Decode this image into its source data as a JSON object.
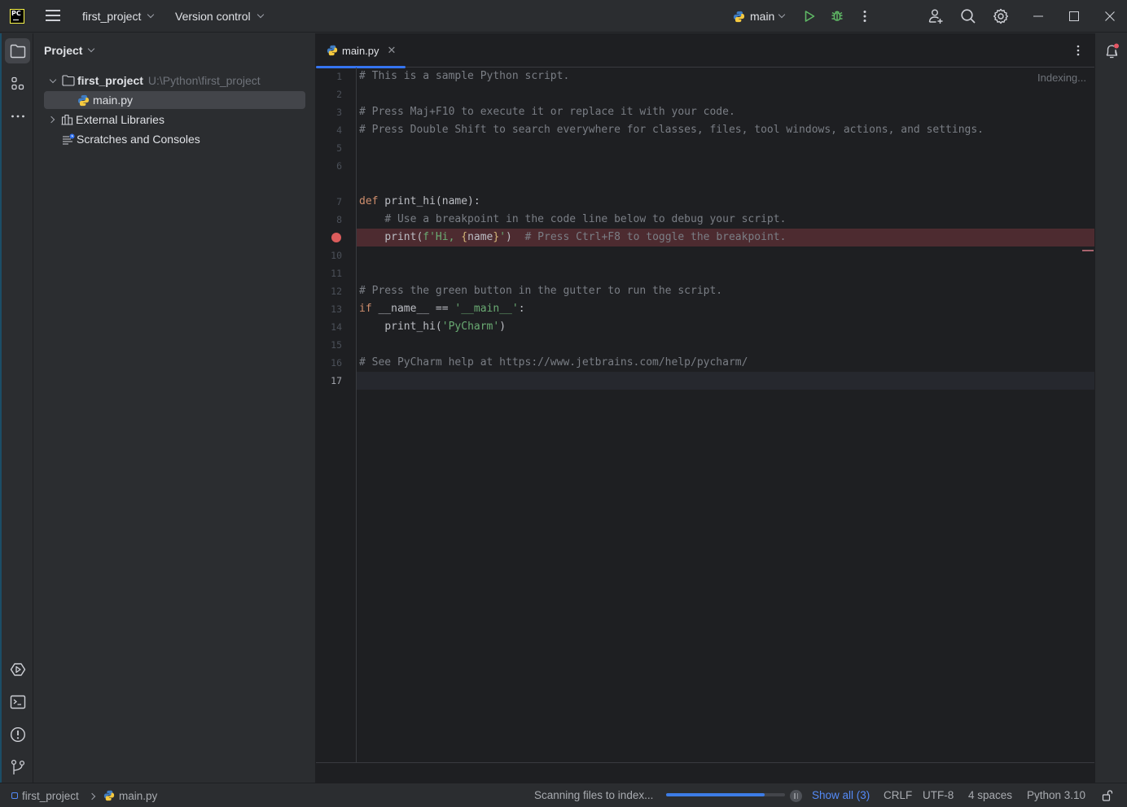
{
  "titlebar": {
    "app_logo_text": "PC",
    "project_name": "first_project",
    "vcs_label": "Version control",
    "run_config": "main"
  },
  "project_pane": {
    "title": "Project",
    "tree": [
      {
        "label": "first_project",
        "path": "U:\\Python\\first_project",
        "type": "folder",
        "expanded": true
      },
      {
        "label": "main.py",
        "type": "python-file",
        "selected": true
      },
      {
        "label": "External Libraries",
        "type": "libraries",
        "expanded": false
      },
      {
        "label": "Scratches and Consoles",
        "type": "scratches"
      }
    ]
  },
  "editor": {
    "tabs": [
      {
        "label": "main.py",
        "active": true
      }
    ],
    "status_hint": "Indexing...",
    "current_line": 17,
    "breakpoint_line": 9,
    "lines": [
      {
        "n": "1",
        "text": "# This is a sample Python script."
      },
      {
        "n": "2",
        "text": ""
      },
      {
        "n": "3",
        "text": "# Press Maj+F10 to execute it or replace it with your code."
      },
      {
        "n": "4",
        "text": "# Press Double Shift to search everywhere for classes, files, tool windows, actions, and settings."
      },
      {
        "n": "5",
        "text": ""
      },
      {
        "n": "6",
        "text": ""
      },
      {
        "n": "7",
        "text": "def print_hi(name):"
      },
      {
        "n": "8",
        "text": "    # Use a breakpoint in the code line below to debug your script."
      },
      {
        "n": "9",
        "text": "    print(f'Hi, {name}')  # Press Ctrl+F8 to toggle the breakpoint."
      },
      {
        "n": "10",
        "text": ""
      },
      {
        "n": "11",
        "text": ""
      },
      {
        "n": "12",
        "text": "# Press the green button in the gutter to run the script."
      },
      {
        "n": "13",
        "text": "if __name__ == '__main__':"
      },
      {
        "n": "14",
        "text": "    print_hi('PyCharm')"
      },
      {
        "n": "15",
        "text": ""
      },
      {
        "n": "16",
        "text": "# See PyCharm help at https://www.jetbrains.com/help/pycharm/"
      },
      {
        "n": "17",
        "text": ""
      }
    ],
    "tokens": {
      "l1": "# This is a sample Python script.",
      "l3": "# Press Maj+F10 to execute it or replace it with your code.",
      "l4": "# Press Double Shift to search everywhere for classes, files, tool windows, actions, and settings.",
      "l7_kw": "def",
      "l7_rest": " print_hi(name):",
      "l8": "# Use a breakpoint in the code line below to debug your script.",
      "l9_a": "print(",
      "l9_str1": "f'Hi, ",
      "l9_br1": "{",
      "l9_var": "name",
      "l9_br2": "}",
      "l9_str2": "'",
      "l9_b": ")  ",
      "l9_cmt": "# Press Ctrl+F8 to toggle the breakpoint.",
      "l12": "# Press the green button in the gutter to run the script.",
      "l13_kw": "if",
      "l13_a": " __name__ == ",
      "l13_str": "'__main__'",
      "l13_b": ":",
      "l14_a": "print_hi(",
      "l14_str": "'PyCharm'",
      "l14_b": ")",
      "l16": "# See PyCharm help at https://www.jetbrains.com/help/pycharm/"
    }
  },
  "statusbar": {
    "breadcrumb": [
      "first_project",
      "main.py"
    ],
    "progress_label": "Scanning files to index...",
    "progress_fraction": 0.83,
    "show_all": "Show all (3)",
    "line_separator": "CRLF",
    "encoding": "UTF-8",
    "indent": "4 spaces",
    "interpreter": "Python 3.10"
  },
  "colors": {
    "accent": "#3574f0",
    "run_green": "#5fb865",
    "breakpoint_red": "#db5c5c",
    "notification_dot": "#e55765"
  }
}
